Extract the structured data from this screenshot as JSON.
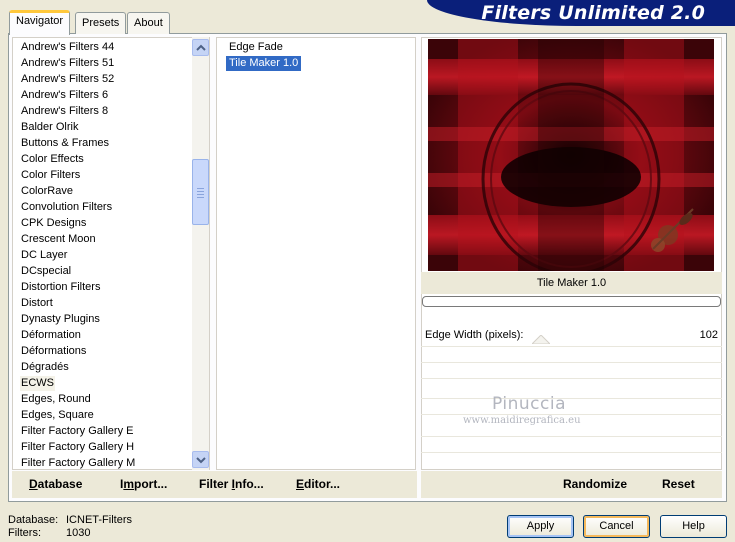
{
  "window": {
    "title": "Filters Unlimited 2.0"
  },
  "tabs": [
    {
      "label": "Navigator",
      "active": true
    },
    {
      "label": "Presets",
      "active": false
    },
    {
      "label": "About",
      "active": false
    }
  ],
  "categories": {
    "items": [
      "Andrew's Filters 44",
      "Andrew's Filters 51",
      "Andrew's Filters 52",
      "Andrew's Filters 6",
      "Andrew's Filters 8",
      "Balder Olrik",
      "Buttons & Frames",
      "Color Effects",
      "Color Filters",
      "ColorRave",
      "Convolution Filters",
      "CPK Designs",
      "Crescent Moon",
      "DC Layer",
      "DCspecial",
      "Distortion Filters",
      "Distort",
      "Dynasty Plugins",
      "Déformation",
      "Déformations",
      "Dégradés",
      "ECWS",
      "Edges, Round",
      "Edges, Square",
      "Filter Factory Gallery E",
      "Filter Factory Gallery H",
      "Filter Factory Gallery M"
    ],
    "selected": "ECWS"
  },
  "filters": {
    "items": [
      "Edge Fade",
      "Tile Maker 1.0"
    ],
    "selected": "Tile Maker 1.0"
  },
  "preview": {
    "caption": "Tile Maker 1.0",
    "progress": 0
  },
  "parameters": [
    {
      "label": "Edge Width (pixels):",
      "value": "102"
    }
  ],
  "toolbar": {
    "database_underline": "D",
    "database_rest": "atabase",
    "import_pre": "I",
    "import_underline": "m",
    "import_rest": "port...",
    "filterinfo_pre": "Filter ",
    "filterinfo_underline": "I",
    "filterinfo_rest": "nfo...",
    "editor_underline": "E",
    "editor_rest": "ditor...",
    "randomize": "Randomize",
    "reset": "Reset"
  },
  "watermark": {
    "name": "Pinuccia",
    "url": "www.maidiregrafica.eu"
  },
  "status": {
    "database_label": "Database:",
    "database_value": "ICNET-Filters",
    "filters_label": "Filters:",
    "filters_value": "1030"
  },
  "buttons": {
    "apply": "Apply",
    "cancel": "Cancel",
    "help": "Help"
  },
  "colors": {
    "banner": "#0a1f7a",
    "selection": "#316ac5",
    "preview_red": "#b4121d"
  }
}
